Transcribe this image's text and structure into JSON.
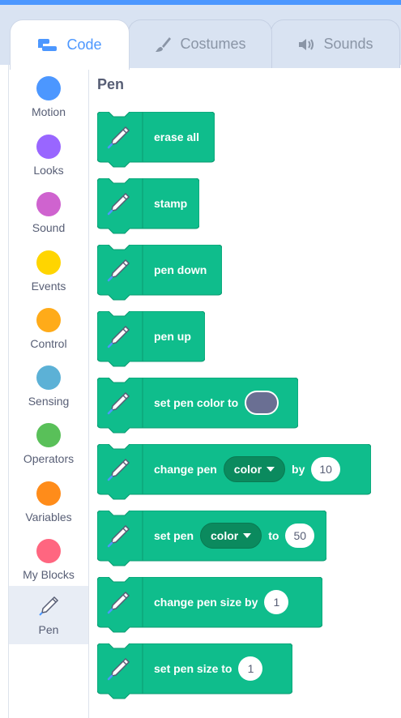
{
  "tabs": [
    {
      "label": "Code",
      "icon": "code-icon",
      "active": true
    },
    {
      "label": "Costumes",
      "icon": "brush-icon",
      "active": false
    },
    {
      "label": "Sounds",
      "icon": "speaker-icon",
      "active": false
    }
  ],
  "categories": [
    {
      "label": "Motion",
      "color": "#4c97ff"
    },
    {
      "label": "Looks",
      "color": "#9966ff"
    },
    {
      "label": "Sound",
      "color": "#cf63cf"
    },
    {
      "label": "Events",
      "color": "#ffd500"
    },
    {
      "label": "Control",
      "color": "#ffab19"
    },
    {
      "label": "Sensing",
      "color": "#5cb1d6"
    },
    {
      "label": "Operators",
      "color": "#59c059"
    },
    {
      "label": "Variables",
      "color": "#ff8c1a"
    },
    {
      "label": "My Blocks",
      "color": "#ff6680"
    },
    {
      "label": "Pen",
      "icon": "pen-icon",
      "selected": true
    }
  ],
  "palette": {
    "title": "Pen",
    "block_color": "#0fbd8c",
    "blocks": {
      "erase_all": {
        "label": "erase all"
      },
      "stamp": {
        "label": "stamp"
      },
      "pen_down": {
        "label": "pen down"
      },
      "pen_up": {
        "label": "pen up"
      },
      "set_pen_color": {
        "label": "set pen color to",
        "color_value": "#6a6f93"
      },
      "change_pen": {
        "label": "change pen",
        "param": "color",
        "by_label": "by",
        "value": "10"
      },
      "set_pen": {
        "label": "set pen",
        "param": "color",
        "to_label": "to",
        "value": "50"
      },
      "change_pen_size": {
        "label": "change pen size by",
        "value": "1"
      },
      "set_pen_size": {
        "label": "set pen size to",
        "value": "1"
      }
    }
  }
}
